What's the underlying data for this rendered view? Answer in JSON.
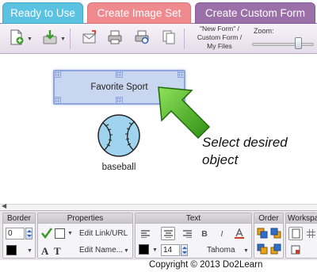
{
  "tabs": [
    {
      "label": "Ready to Use"
    },
    {
      "label": "Create Image Set"
    },
    {
      "label": "Create Custom Form"
    }
  ],
  "toolbar": {
    "path_line1": "\"New Form\" /",
    "path_line2": "Custom Form /",
    "path_line3": "My Files",
    "zoom_label": "Zoom:",
    "zoom_level": 0.78
  },
  "canvas": {
    "selected_card_label": "Favorite Sport",
    "image_label": "baseball",
    "hint_text": "Select desired object"
  },
  "ribbon": {
    "border": {
      "title": "Border",
      "width_value": "0"
    },
    "properties": {
      "title": "Properties",
      "edit_link": "Edit Link/URL",
      "edit_name": "Edit Name..."
    },
    "text": {
      "title": "Text",
      "bold": "B",
      "italic": "I",
      "size_value": "14",
      "font_value": "Tahoma"
    },
    "order": {
      "title": "Order"
    },
    "workspace": {
      "title": "Workspa"
    }
  },
  "colors": {
    "tab_ready": "#5cc2e2",
    "tab_image_set": "#ef8a8e",
    "tab_custom_form": "#9b6fa8",
    "selection": "#c9d6f0",
    "arrow": "#3aa81c"
  },
  "footer": {
    "copyright": "Copyright © 2013 Do2Learn"
  }
}
